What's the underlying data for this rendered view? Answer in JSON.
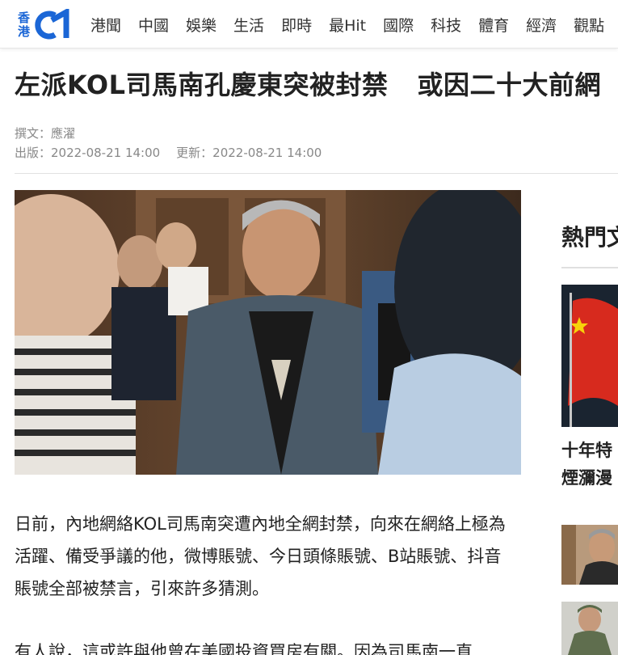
{
  "brand": {
    "logo_text_line1": "香",
    "logo_text_line2": "港",
    "logo_mark": "01",
    "accent_color": "#1b66d6"
  },
  "nav": {
    "items": [
      "港聞",
      "中國",
      "娛樂",
      "生活",
      "即時",
      "最Hit",
      "國際",
      "科技",
      "體育",
      "經濟",
      "觀點"
    ]
  },
  "article": {
    "title_part1": "左派KOL司馬南孔慶東突被封禁",
    "title_part2": "或因二十大前網",
    "author": "撰文：應濯",
    "published": "出版：2022-08-21 14:00",
    "updated": "更新：2022-08-21 14:00",
    "paragraph1": "日前，內地網絡KOL司馬南突遭內地全網封禁，向來在網絡上極為活躍、備受爭議的他，微博賬號、今日頭條賬號、B站賬號、抖音賬號全部被禁言，引來許多猜測。",
    "paragraph2": "有人說，這或許與他曾在美國投資買房有關。因為司馬南一直"
  },
  "sidebar": {
    "title": "熱門文",
    "story1_line1": "十年特",
    "story1_line2": "煙瀰漫"
  }
}
